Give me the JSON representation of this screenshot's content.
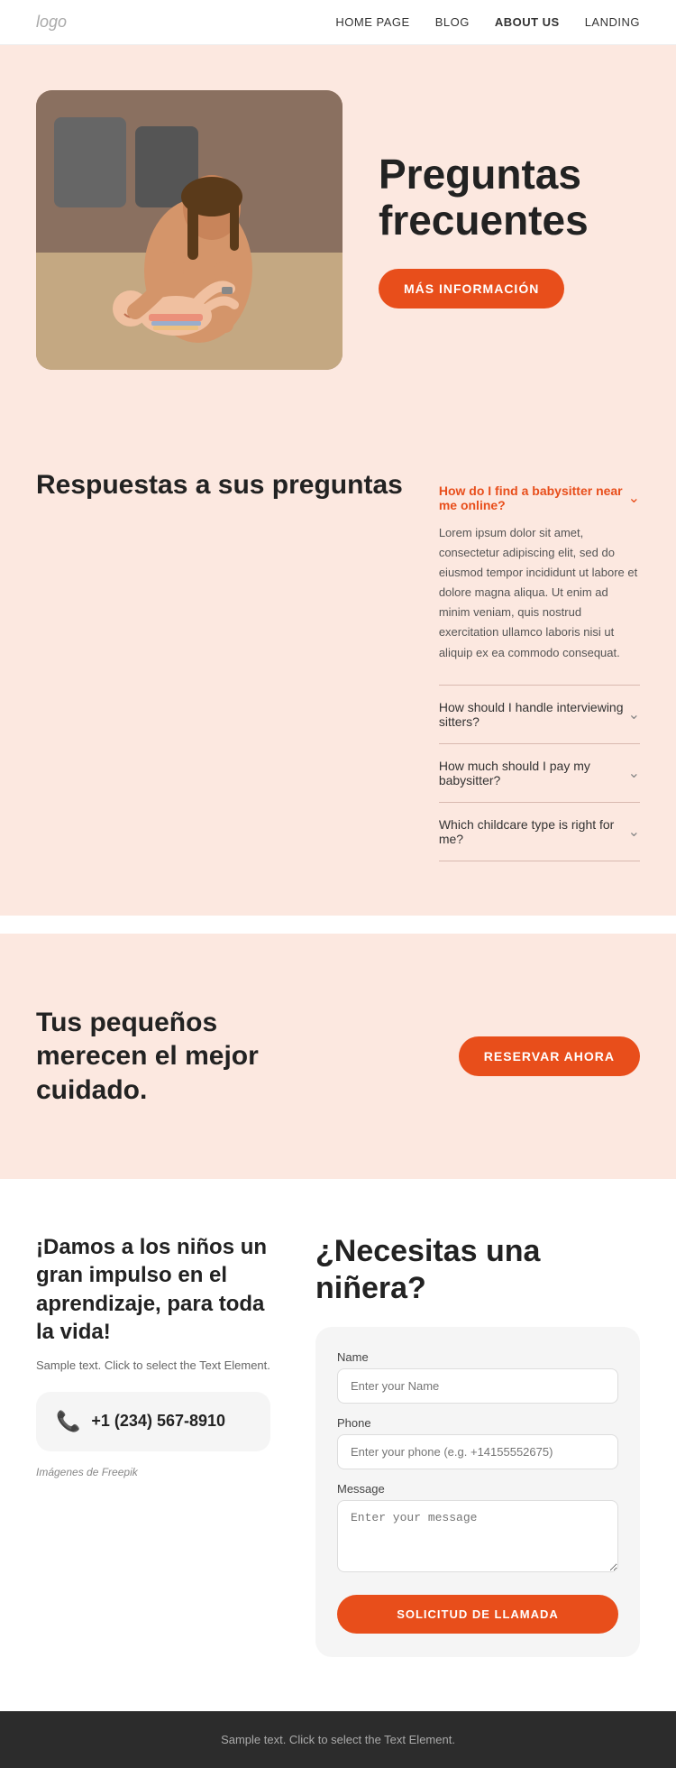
{
  "nav": {
    "logo": "logo",
    "links": [
      {
        "label": "HOME PAGE",
        "active": false
      },
      {
        "label": "BLOG",
        "active": false
      },
      {
        "label": "ABOUT US",
        "active": true
      },
      {
        "label": "LANDING",
        "active": false
      }
    ]
  },
  "hero": {
    "title": "Preguntas frecuentes",
    "cta_label": "MÁS INFORMACIÓN"
  },
  "faq": {
    "section_title": "Respuestas a sus preguntas",
    "items": [
      {
        "question": "How do I find a babysitter near me online?",
        "open": true,
        "answer": "Lorem ipsum dolor sit amet, consectetur adipiscing elit, sed do eiusmod tempor incididunt ut labore et dolore magna aliqua. Ut enim ad minim veniam, quis nostrud exercitation ullamco laboris nisi ut aliquip ex ea commodo consequat."
      },
      {
        "question": "How should I handle interviewing sitters?",
        "open": false,
        "answer": ""
      },
      {
        "question": "How much should I pay my babysitter?",
        "open": false,
        "answer": ""
      },
      {
        "question": "Which childcare type is right for me?",
        "open": false,
        "answer": ""
      }
    ]
  },
  "cta_band": {
    "title": "Tus pequeños merecen el mejor cuidado.",
    "button_label": "RESERVAR AHORA"
  },
  "contact": {
    "left_title": "¡Damos a los niños un gran impulso en el aprendizaje, para toda la vida!",
    "sample_text": "Sample text. Click to select the Text Element.",
    "phone": "+1 (234) 567-8910",
    "credit": "Imágenes de Freepik",
    "form_title": "¿Necesitas una niñera?",
    "form": {
      "name_label": "Name",
      "name_placeholder": "Enter your Name",
      "phone_label": "Phone",
      "phone_placeholder": "Enter your phone (e.g. +14155552675)",
      "message_label": "Message",
      "message_placeholder": "Enter your message",
      "submit_label": "SOLICITUD DE LLAMADA"
    }
  },
  "footer": {
    "text": "Sample text. Click to select the Text Element."
  }
}
